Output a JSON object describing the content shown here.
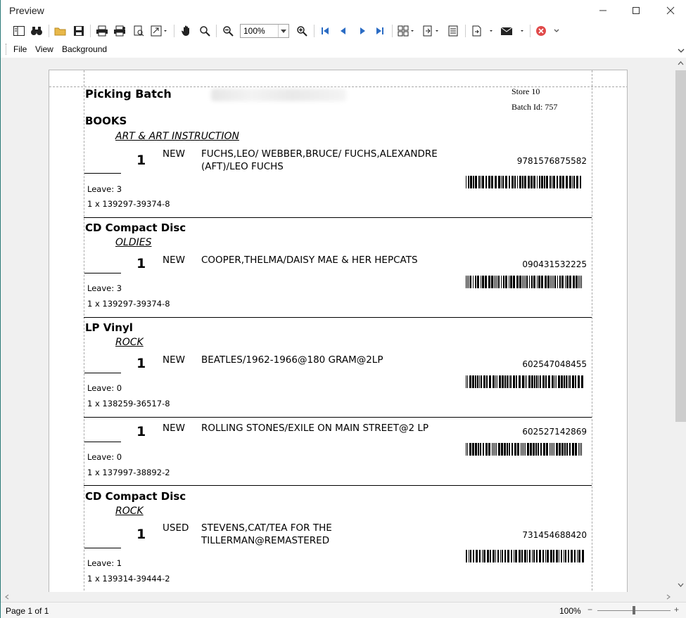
{
  "window": {
    "title": "Preview"
  },
  "toolbar": {
    "zoom_value": "100%"
  },
  "menu": {
    "items": [
      "File",
      "View",
      "Background"
    ]
  },
  "report": {
    "title": "Picking Batch",
    "store": "Store 10",
    "batch": "Batch Id: 757",
    "entries": [
      {
        "category": "BOOKS",
        "subcategory": "ART & ART INSTRUCTION",
        "qty": "1",
        "condition": "NEW",
        "desc_line1": "FUCHS,LEO/ WEBBER,BRUCE/ FUCHS,ALEXANDRE",
        "desc_line2": "(AFT)/LEO FUCHS",
        "isbn": "9781576875582",
        "leave": "Leave: 3",
        "code": "1 x 139297-39374-8"
      },
      {
        "category": "CD Compact Disc",
        "subcategory": "OLDIES",
        "qty": "1",
        "condition": "NEW",
        "desc_line1": "COOPER,THELMA/DAISY MAE & HER HEPCATS",
        "desc_line2": "",
        "isbn": "090431532225",
        "leave": "Leave: 3",
        "code": "1 x 139297-39374-8"
      },
      {
        "category": "LP Vinyl",
        "subcategory": "ROCK",
        "qty": "1",
        "condition": "NEW",
        "desc_line1": "BEATLES/1962-1966@180 GRAM@2LP",
        "desc_line2": "",
        "isbn": "602547048455",
        "leave": "Leave: 0",
        "code": "1 x 138259-36517-8"
      },
      {
        "category": "",
        "subcategory": "",
        "qty": "1",
        "condition": "NEW",
        "desc_line1": "ROLLING STONES/EXILE ON MAIN STREET@2 LP",
        "desc_line2": "",
        "isbn": "602527142869",
        "leave": "Leave: 0",
        "code": "1 x 137997-38892-2"
      },
      {
        "category": "CD Compact Disc",
        "subcategory": "ROCK",
        "qty": "1",
        "condition": "USED",
        "desc_line1": "STEVENS,CAT/TEA FOR THE",
        "desc_line2": "TILLERMAN@REMASTERED",
        "isbn": "731454688420",
        "leave": "Leave: 1",
        "code": "1 x 139314-39444-2"
      }
    ]
  },
  "status": {
    "page": "Page 1 of 1",
    "zoom": "100%",
    "zoom_out": "−",
    "zoom_in": "+"
  }
}
